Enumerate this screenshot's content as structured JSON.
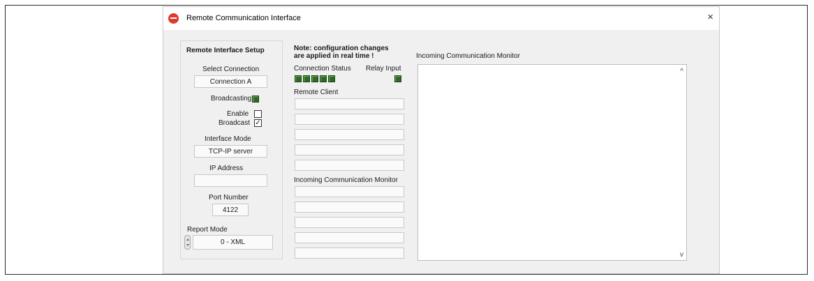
{
  "window": {
    "title": "Remote Communication Interface",
    "close_glyph": "×"
  },
  "setup": {
    "heading": "Remote Interface Setup",
    "select_connection_label": "Select Connection",
    "connection_value": "Connection A",
    "broadcasting_label": "Broadcasting",
    "enable_label": "Enable",
    "broadcast_label": "Broadcast",
    "enable_checked": false,
    "broadcast_checked": true,
    "interface_mode_label": "Interface Mode",
    "interface_mode_value": "TCP-IP server",
    "ip_address_label": "IP Address",
    "ip_address_value": "",
    "port_number_label": "Port Number",
    "port_number_value": "4122",
    "report_mode_label": "Report Mode",
    "report_mode_value": "0 - XML"
  },
  "middle": {
    "note_line1": "Note: configuration changes",
    "note_line2": "are applied in real time !",
    "connection_status_label": "Connection Status",
    "relay_input_label": "Relay Input",
    "remote_client_label": "Remote Client",
    "incoming_monitor_label": "Incoming Communication Monitor"
  },
  "monitor": {
    "label": "Incoming Communication Monitor",
    "scroll_up_glyph": "^",
    "scroll_down_glyph": "v"
  },
  "colors": {
    "led_green": "#2e6a23",
    "accent_red": "#e03a2d"
  }
}
